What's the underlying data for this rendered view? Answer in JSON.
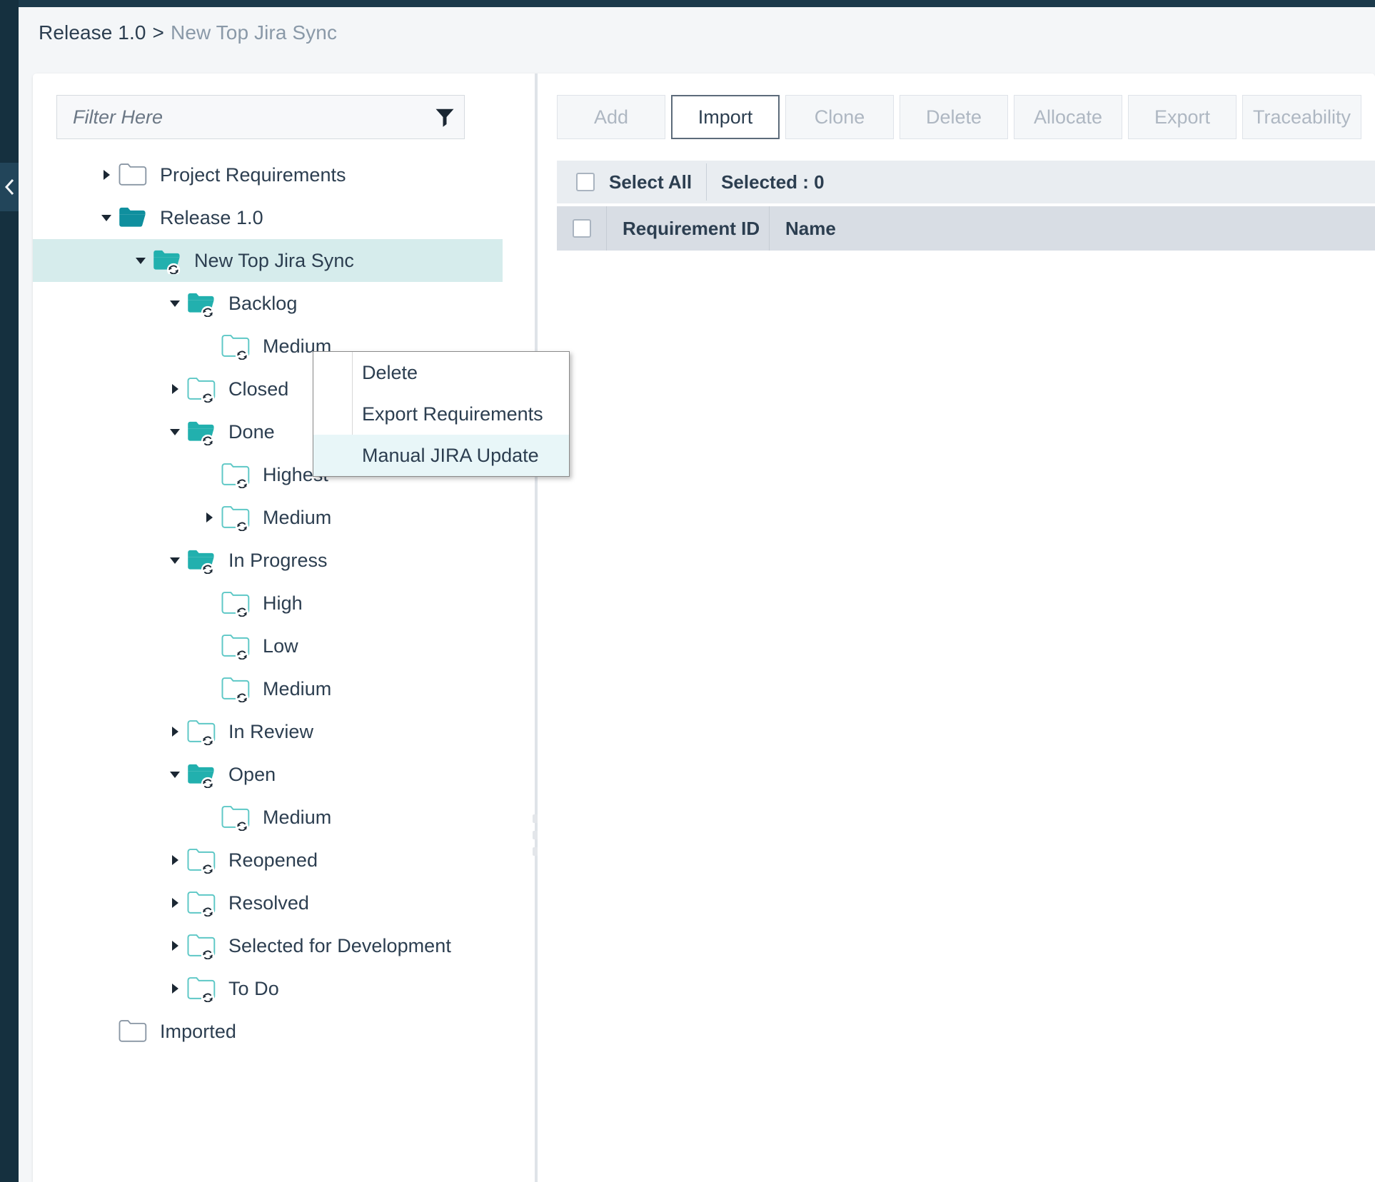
{
  "breadcrumb": {
    "root": "Release 1.0",
    "separator": ">",
    "current": "New Top Jira Sync"
  },
  "filter": {
    "placeholder": "Filter Here",
    "value": "",
    "icon": "filter-funnel-icon"
  },
  "tree": {
    "nodes": [
      {
        "label": "Project Requirements",
        "depth": 0,
        "twisty": "collapsed",
        "icon": "folder-plain-closed",
        "selected": false
      },
      {
        "label": "Release 1.0",
        "depth": 0,
        "twisty": "expanded",
        "icon": "folder-solid-open",
        "selected": false
      },
      {
        "label": "New Top Jira Sync",
        "depth": 1,
        "twisty": "expanded",
        "icon": "folder-solid-sync",
        "selected": true
      },
      {
        "label": "Backlog",
        "depth": 2,
        "twisty": "expanded",
        "icon": "folder-solid-sync",
        "selected": false
      },
      {
        "label": "Medium",
        "depth": 3,
        "twisty": "none",
        "icon": "folder-outline-sync",
        "selected": false
      },
      {
        "label": "Closed",
        "depth": 2,
        "twisty": "collapsed",
        "icon": "folder-outline-sync",
        "selected": false
      },
      {
        "label": "Done",
        "depth": 2,
        "twisty": "expanded",
        "icon": "folder-solid-sync",
        "selected": false
      },
      {
        "label": "Highest",
        "depth": 3,
        "twisty": "none",
        "icon": "folder-outline-sync",
        "selected": false
      },
      {
        "label": "Medium",
        "depth": 3,
        "twisty": "collapsed",
        "icon": "folder-outline-sync",
        "selected": false
      },
      {
        "label": "In Progress",
        "depth": 2,
        "twisty": "expanded",
        "icon": "folder-solid-sync",
        "selected": false
      },
      {
        "label": "High",
        "depth": 3,
        "twisty": "none",
        "icon": "folder-outline-sync",
        "selected": false
      },
      {
        "label": "Low",
        "depth": 3,
        "twisty": "none",
        "icon": "folder-outline-sync",
        "selected": false
      },
      {
        "label": "Medium",
        "depth": 3,
        "twisty": "none",
        "icon": "folder-outline-sync",
        "selected": false
      },
      {
        "label": "In Review",
        "depth": 2,
        "twisty": "collapsed",
        "icon": "folder-outline-sync",
        "selected": false
      },
      {
        "label": "Open",
        "depth": 2,
        "twisty": "expanded",
        "icon": "folder-solid-sync",
        "selected": false
      },
      {
        "label": "Medium",
        "depth": 3,
        "twisty": "none",
        "icon": "folder-outline-sync",
        "selected": false
      },
      {
        "label": "Reopened",
        "depth": 2,
        "twisty": "collapsed",
        "icon": "folder-outline-sync",
        "selected": false
      },
      {
        "label": "Resolved",
        "depth": 2,
        "twisty": "collapsed",
        "icon": "folder-outline-sync",
        "selected": false
      },
      {
        "label": "Selected for Development",
        "depth": 2,
        "twisty": "collapsed",
        "icon": "folder-outline-sync",
        "selected": false
      },
      {
        "label": "To Do",
        "depth": 2,
        "twisty": "collapsed",
        "icon": "folder-outline-sync",
        "selected": false
      },
      {
        "label": "Imported",
        "depth": 0,
        "twisty": "none",
        "icon": "folder-plain-closed",
        "selected": false
      }
    ]
  },
  "context_menu": {
    "items": [
      {
        "label": "Delete",
        "highlighted": false
      },
      {
        "label": "Export Requirements",
        "highlighted": false
      },
      {
        "label": "Manual JIRA Update",
        "highlighted": true
      }
    ]
  },
  "toolbar": {
    "buttons": [
      {
        "label": "Add",
        "state": "disabled"
      },
      {
        "label": "Import",
        "state": "active"
      },
      {
        "label": "Clone",
        "state": "disabled"
      },
      {
        "label": "Delete",
        "state": "disabled"
      },
      {
        "label": "Allocate",
        "state": "disabled"
      },
      {
        "label": "Export",
        "state": "disabled"
      },
      {
        "label": "Traceability",
        "state": "disabled"
      }
    ]
  },
  "selection_bar": {
    "select_all_label": "Select All",
    "selected_count_label": "Selected : 0",
    "checked": false
  },
  "table": {
    "columns": [
      "Requirement ID",
      "Name"
    ],
    "rows": []
  },
  "colors": {
    "accent_teal": "#0f8f9e",
    "folder_solid": "#22b0ae",
    "folder_outline": "#5ec8c6",
    "folder_plain": "#8996a4",
    "selected_row": "#d6ecec",
    "menu_highlight": "#e8f6f8",
    "rail_dark": "#15303f",
    "text_primary": "#2c3e50",
    "text_muted": "#8a99a8",
    "btn_disabled_text": "#aeb7c2"
  }
}
